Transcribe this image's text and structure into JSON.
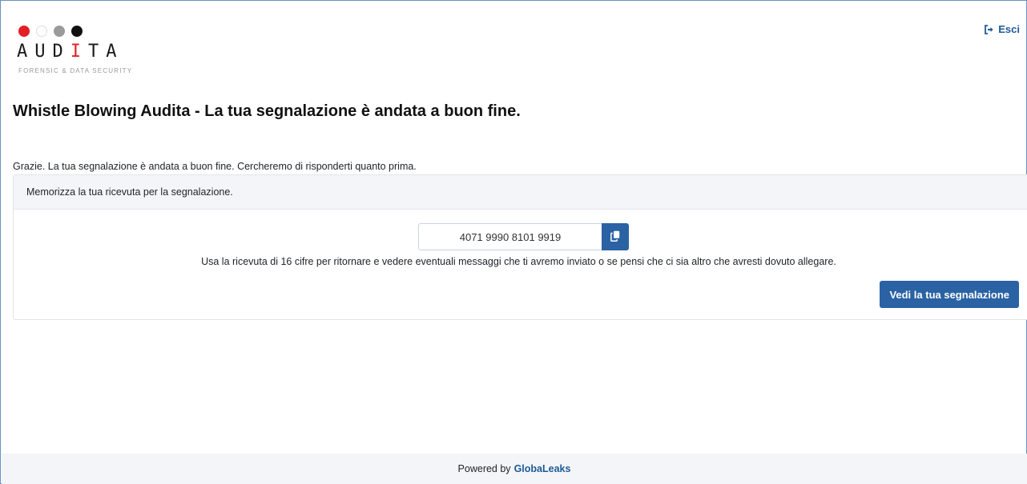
{
  "header": {
    "logo": {
      "dots": [
        "#e21f26",
        "#ffffff",
        "#9a9a9a",
        "#111111"
      ],
      "wordmark": [
        "A",
        "U",
        "D",
        "I",
        "T",
        "A"
      ],
      "accent_letter_index": 3,
      "tagline": "FORENSIC & DATA SECURITY"
    },
    "logout_label": "Esci",
    "logout_icon": "sign-out-icon"
  },
  "page": {
    "title": "Whistle Blowing Audita - La tua segnalazione è andata a buon fine.",
    "thanks_message": "Grazie. La tua segnalazione è andata a buon fine. Cercheremo di risponderti quanto prima."
  },
  "receipt_card": {
    "header": "Memorizza la tua ricevuta per la segnalazione.",
    "receipt_code": "4071 9990 8101 9919",
    "copy_icon": "copy-icon",
    "instructions": "Usa la ricevuta di 16 cifre per ritornare e vedere eventuali messaggi che ti avremo inviato o se pensi che ci sia altro che avresti dovuto allegare.",
    "view_button_label": "Vedi la tua segnalazione"
  },
  "footer": {
    "powered_by": "Powered by",
    "link_label": "GlobaLeaks"
  },
  "colors": {
    "primary": "#2a62a4",
    "link": "#1f5a96",
    "logo_red": "#e21f26",
    "panel_bg": "#f4f5f8"
  }
}
